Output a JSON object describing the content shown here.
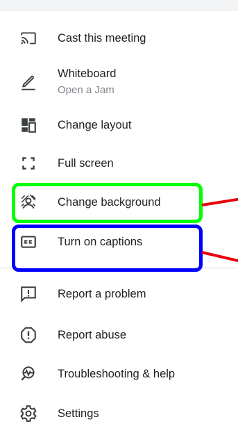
{
  "menu": {
    "items": [
      {
        "label": "Cast this meeting",
        "icon": "cast-icon"
      },
      {
        "label": "Whiteboard",
        "sublabel": "Open a Jam",
        "icon": "pen-icon"
      },
      {
        "label": "Change layout",
        "icon": "layout-icon"
      },
      {
        "label": "Full screen",
        "icon": "fullscreen-icon"
      },
      {
        "label": "Change background",
        "icon": "background-icon"
      },
      {
        "label": "Turn on captions",
        "icon": "captions-icon"
      },
      {
        "label": "Report a problem",
        "icon": "report-problem-icon"
      },
      {
        "label": "Report abuse",
        "icon": "report-abuse-icon"
      },
      {
        "label": "Troubleshooting & help",
        "icon": "troubleshooting-icon"
      },
      {
        "label": "Settings",
        "icon": "gear-icon"
      }
    ]
  },
  "colors": {
    "text": "#202124",
    "secondary_text": "#80868b",
    "icon": "#3c4043",
    "highlight_green": "#00ff00",
    "highlight_blue": "#0000ff",
    "annotation_red": "#e8000b"
  }
}
